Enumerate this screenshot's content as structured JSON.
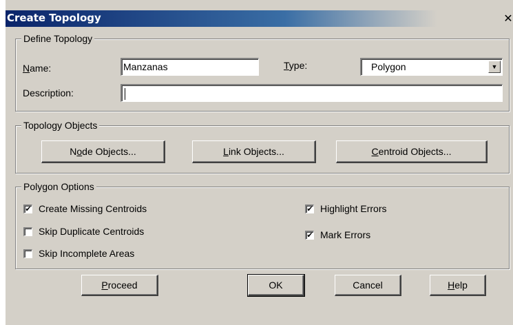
{
  "dialog": {
    "title": "Create Topology",
    "close_glyph": "✕"
  },
  "define": {
    "group_label": "Define Topology",
    "name_label_u": "N",
    "name_label_rest": "ame:",
    "name_value": "Manzanas",
    "type_label_u": "T",
    "type_label_rest": "ype:",
    "type_value": "Polygon",
    "description_label": "Description:",
    "description_value": ""
  },
  "objects": {
    "group_label": "Topology Objects",
    "node_pre": "N",
    "node_u": "o",
    "node_rest": "de Objects...",
    "link_u": "L",
    "link_rest": "ink Objects...",
    "centroid_u": "C",
    "centroid_rest": "entroid Objects..."
  },
  "polygon": {
    "group_label": "Polygon Options",
    "options": [
      {
        "label": "Create Missing Centroids",
        "checked": true
      },
      {
        "label": "Skip Duplicate Centroids",
        "checked": false
      },
      {
        "label": "Skip Incomplete Areas",
        "checked": false
      },
      {
        "label": "Highlight Errors",
        "checked": true
      },
      {
        "label": "Mark Errors",
        "checked": true
      }
    ],
    "check_glyph": "✔"
  },
  "footer": {
    "proceed_u": "P",
    "proceed_rest": "roceed",
    "ok": "OK",
    "cancel": "Cancel",
    "help_u": "H",
    "help_rest": "elp"
  },
  "icons": {
    "dropdown": "▼"
  }
}
